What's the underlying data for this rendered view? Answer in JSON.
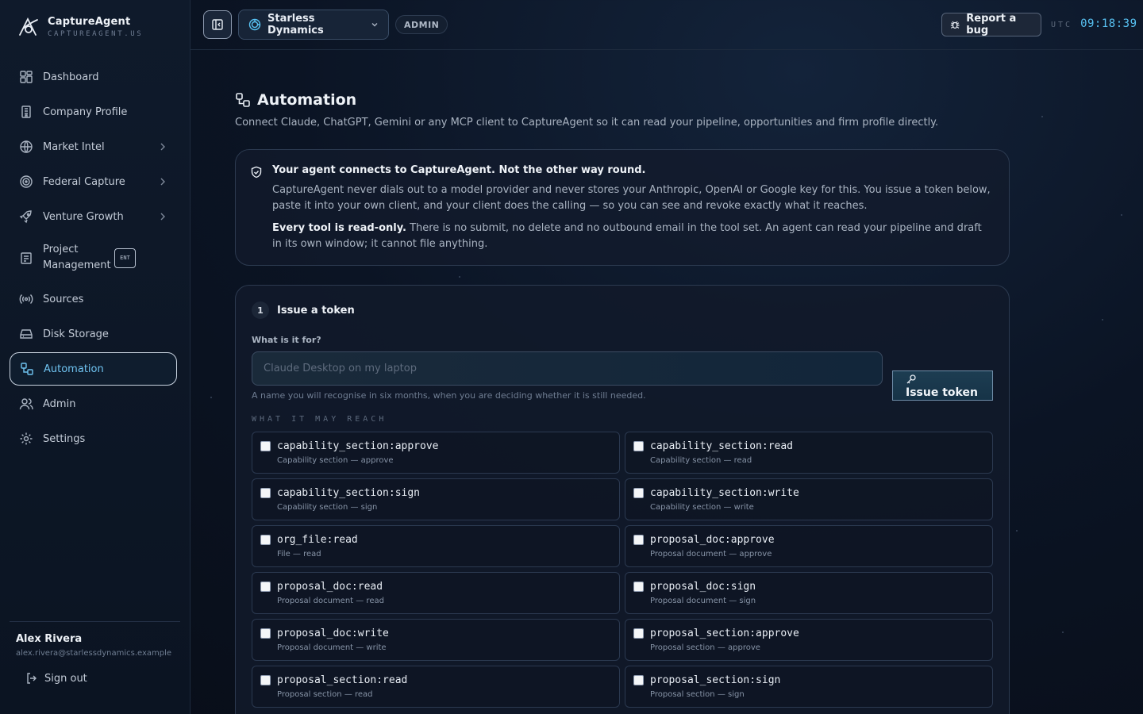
{
  "brand": {
    "name": "CaptureAgent",
    "domain": "CAPTUREAGENT.US"
  },
  "sidebar": {
    "items": [
      {
        "label": "Dashboard",
        "icon": "dashboard-icon"
      },
      {
        "label": "Company Profile",
        "icon": "building-icon"
      },
      {
        "label": "Market Intel",
        "icon": "globe-icon",
        "chevron": true
      },
      {
        "label": "Federal Capture",
        "icon": "target-icon",
        "chevron": true
      },
      {
        "label": "Venture Growth",
        "icon": "rocket-icon",
        "chevron": true
      },
      {
        "label": "Project Management",
        "icon": "clipboard-icon",
        "badge": "ENT"
      },
      {
        "label": "Sources",
        "icon": "broadcast-icon"
      },
      {
        "label": "Disk Storage",
        "icon": "hard-drive-icon"
      },
      {
        "label": "Automation",
        "icon": "workflow-icon",
        "active": true
      },
      {
        "label": "Admin",
        "icon": "users-icon"
      },
      {
        "label": "Settings",
        "icon": "gear-icon"
      }
    ]
  },
  "user": {
    "name": "Alex Rivera",
    "email": "alex.rivera@starlessdynamics.example",
    "signout_label": "Sign out"
  },
  "topbar": {
    "org_name": "Starless Dynamics",
    "role": "ADMIN",
    "bug_label": "Report a bug",
    "tz": "UTC",
    "time": "09:18:39"
  },
  "page": {
    "title": "Automation",
    "subtitle": "Connect Claude, ChatGPT, Gemini or any MCP client to CaptureAgent so it can read your pipeline, opportunities and firm profile directly."
  },
  "notice": {
    "title": "Your agent connects to CaptureAgent. Not the other way round.",
    "body": "CaptureAgent never dials out to a model provider and never stores your Anthropic, OpenAI or Google key for this. You issue a token below, paste it into your own client, and your client does the calling — so you can see and revoke exactly what it reaches.",
    "readonly_strong": "Every tool is read-only.",
    "readonly_rest": " There is no submit, no delete and no outbound email in the tool set. An agent can read your pipeline and draft in its own window; it cannot file anything."
  },
  "token": {
    "step_number": "1",
    "step_title": "Issue a token",
    "field_label": "What is it for?",
    "placeholder": "Claude Desktop on my laptop",
    "help": "A name you will recognise in six months, when you are deciding whether it is still needed.",
    "button_label": "Issue token",
    "reach_label": "WHAT IT MAY REACH",
    "scopes": [
      {
        "code": "capability_section:approve",
        "desc": "Capability section — approve"
      },
      {
        "code": "capability_section:read",
        "desc": "Capability section — read"
      },
      {
        "code": "capability_section:sign",
        "desc": "Capability section — sign"
      },
      {
        "code": "capability_section:write",
        "desc": "Capability section — write"
      },
      {
        "code": "org_file:read",
        "desc": "File — read"
      },
      {
        "code": "proposal_doc:approve",
        "desc": "Proposal document — approve"
      },
      {
        "code": "proposal_doc:read",
        "desc": "Proposal document — read"
      },
      {
        "code": "proposal_doc:sign",
        "desc": "Proposal document — sign"
      },
      {
        "code": "proposal_doc:write",
        "desc": "Proposal document — write"
      },
      {
        "code": "proposal_section:approve",
        "desc": "Proposal section — approve"
      },
      {
        "code": "proposal_section:read",
        "desc": "Proposal section — read"
      },
      {
        "code": "proposal_section:sign",
        "desc": "Proposal section — sign"
      }
    ]
  },
  "colors": {
    "accent": "#58c3f4",
    "active_nav": "#6fc3f0",
    "background": "#0b1424"
  }
}
